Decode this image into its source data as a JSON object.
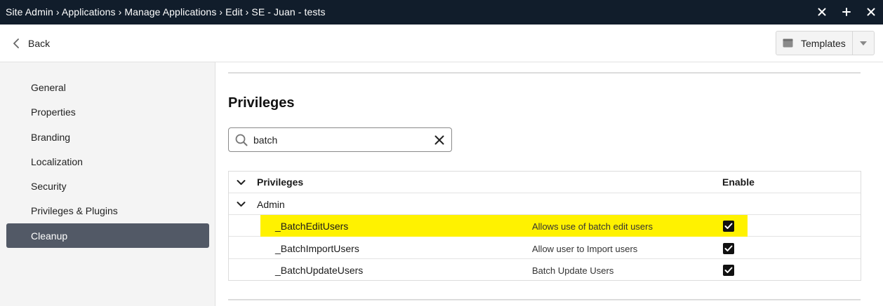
{
  "titlebar": {
    "breadcrumb": "Site Admin › Applications › Manage Applications › Edit › SE - Juan - tests"
  },
  "toolbar": {
    "back_label": "Back",
    "templates_label": "Templates"
  },
  "sidebar": {
    "items": [
      {
        "label": "General"
      },
      {
        "label": "Properties"
      },
      {
        "label": "Branding"
      },
      {
        "label": "Localization"
      },
      {
        "label": "Security"
      },
      {
        "label": "Privileges & Plugins"
      },
      {
        "label": "Cleanup",
        "active": true
      }
    ]
  },
  "main": {
    "section_title": "Privileges",
    "search": {
      "value": "batch"
    },
    "grid": {
      "header_privileges": "Privileges",
      "header_enable": "Enable",
      "group_label": "Admin",
      "rows": [
        {
          "name": "_BatchEditUsers",
          "description": "Allows use of batch edit users",
          "enabled": true,
          "highlighted": true
        },
        {
          "name": "_BatchImportUsers",
          "description": "Allow user to Import users",
          "enabled": true
        },
        {
          "name": "_BatchUpdateUsers",
          "description": "Batch Update Users",
          "enabled": true
        }
      ]
    }
  },
  "colors": {
    "titlebar_bg": "#111d2b",
    "sidebar_active": "#525966",
    "highlight": "#fff200"
  },
  "icons": [
    "close-icon",
    "plus-icon",
    "chevron-left-icon",
    "template-icon",
    "caret-down-icon",
    "search-icon",
    "clear-icon",
    "chevron-down-icon",
    "checkbox-checked-icon"
  ]
}
